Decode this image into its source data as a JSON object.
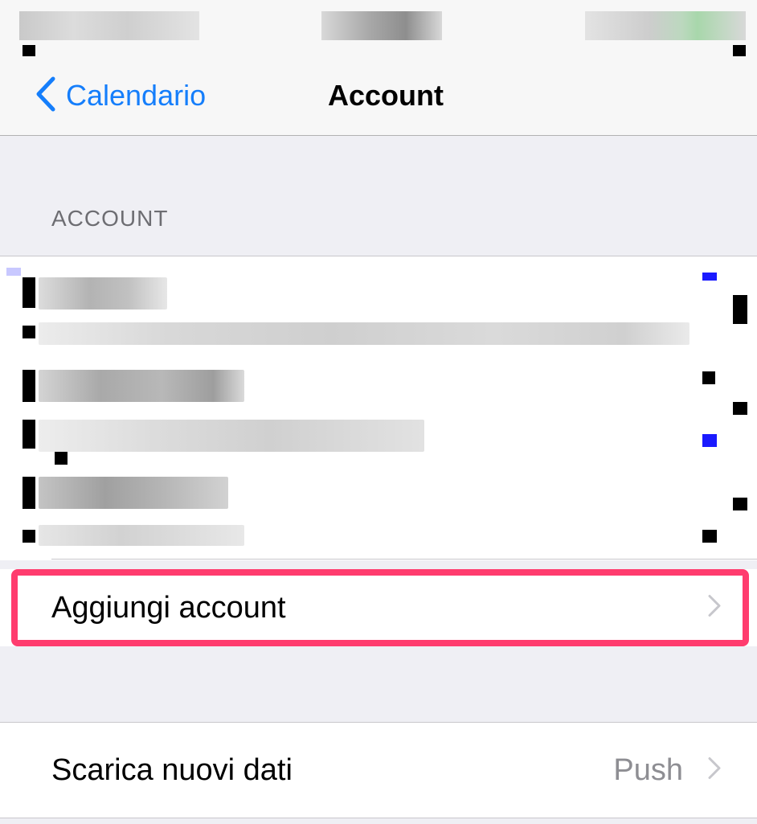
{
  "nav": {
    "back_label": "Calendario",
    "title": "Account"
  },
  "section": {
    "header": "ACCOUNT"
  },
  "add_account": {
    "label": "Aggiungi account"
  },
  "fetch": {
    "label": "Scarica nuovi dati",
    "value": "Push"
  },
  "colors": {
    "accent": "#157efb",
    "highlight": "#ff3c6e",
    "background": "#efeff4"
  }
}
